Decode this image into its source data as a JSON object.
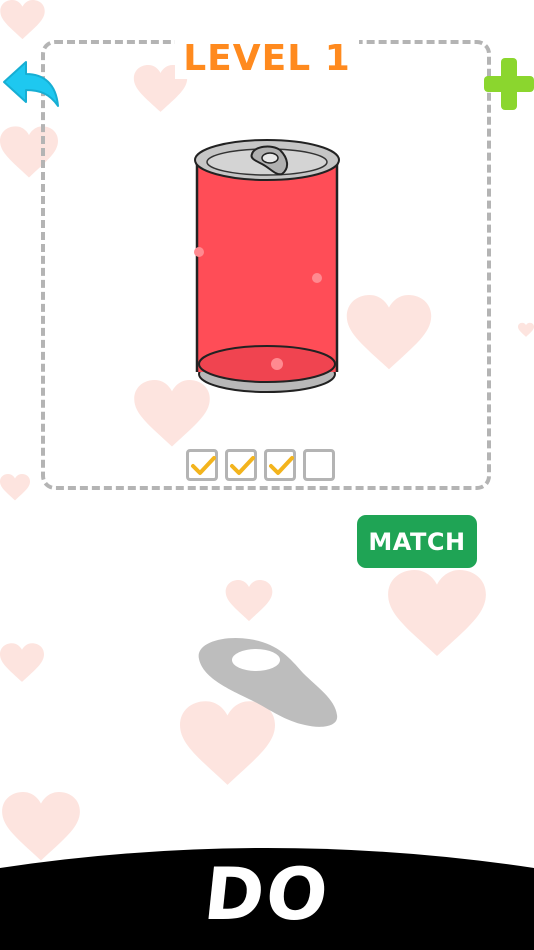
{
  "level": {
    "title": "LEVEL 1"
  },
  "actions": {
    "match_label": "MATCH"
  },
  "target_object": {
    "name": "soda can",
    "color": "#ff4d57"
  },
  "progress": {
    "total": 4,
    "completed": 3,
    "slots": [
      true,
      true,
      true,
      false
    ]
  },
  "draggable_piece": {
    "name": "can tab",
    "color": "#bdbdbd"
  },
  "bottom_bar": {
    "word": "DO"
  },
  "icons": {
    "back": "back-arrow-icon",
    "add": "plus-icon",
    "check": "checkmark-icon"
  },
  "colors": {
    "title_orange": "#ff8a1e",
    "back_blue": "#1ec8f0",
    "plus_green": "#8bd62e",
    "match_green": "#1fa455",
    "heart_pink": "#fde4df",
    "frame_gray": "#b4b4b4",
    "check_gold": "#f3b41d"
  }
}
